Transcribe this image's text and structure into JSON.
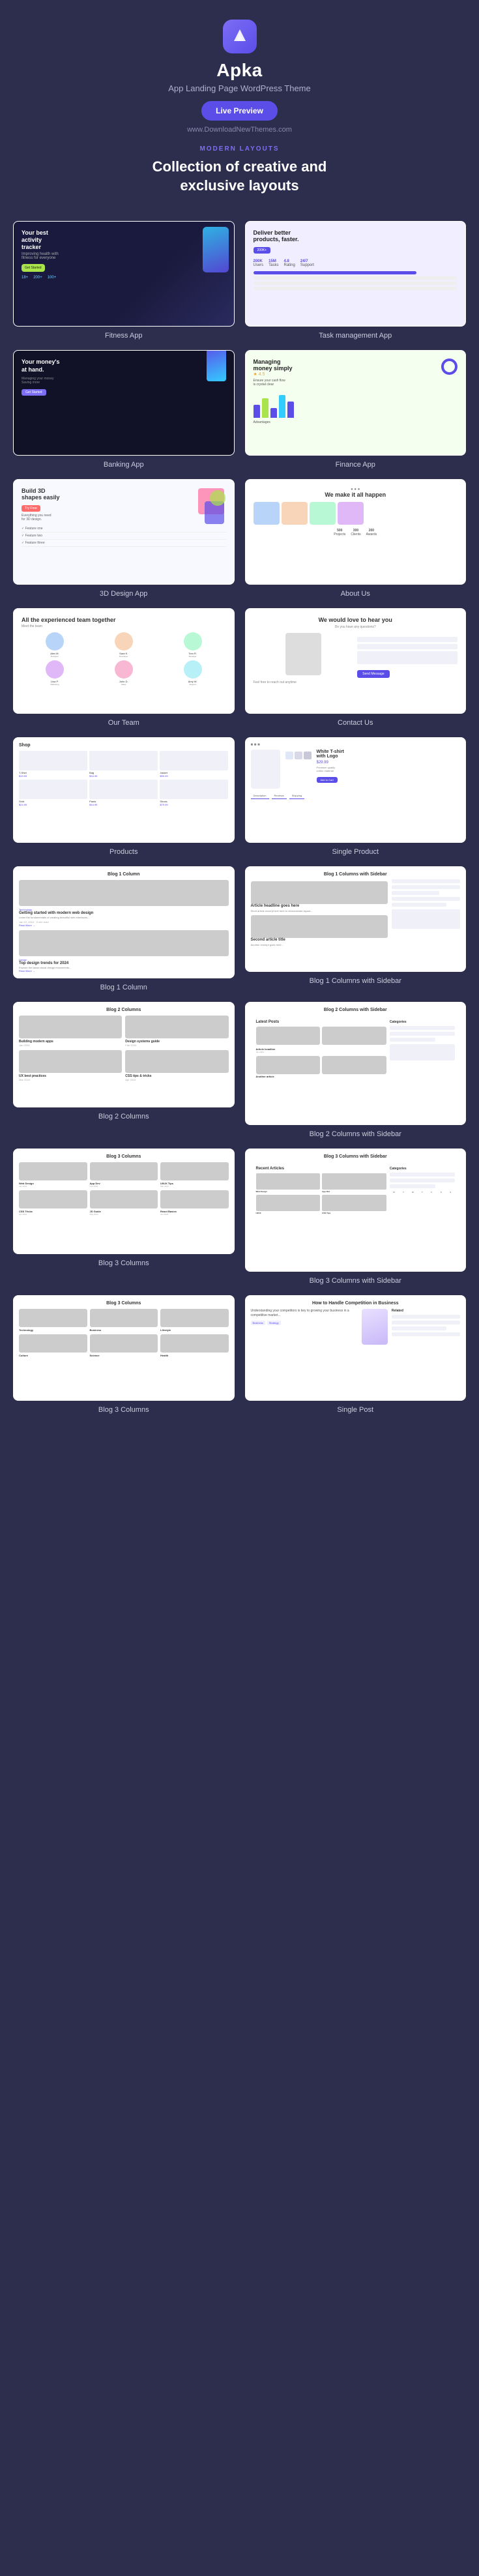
{
  "header": {
    "logo_icon_label": "apka-logo",
    "app_name": "Apka",
    "tagline": "App Landing Page WordPress Theme",
    "live_preview_label": "Live Preview",
    "website_url": "www.DownloadNewThemes.com",
    "section_label": "MODERN LAYOUTS",
    "section_title": "Collection of creative and\nexclusive layouts"
  },
  "layouts": [
    {
      "id": "fitness-app",
      "label": "Fitness App"
    },
    {
      "id": "task-app",
      "label": "Task management App"
    },
    {
      "id": "banking-app",
      "label": "Banking App"
    },
    {
      "id": "finance-app",
      "label": "Finance App"
    },
    {
      "id": "design3d-app",
      "label": "3D Design App"
    },
    {
      "id": "about-us",
      "label": "About Us"
    },
    {
      "id": "our-team",
      "label": "Our Team"
    },
    {
      "id": "contact-us",
      "label": "Contact Us"
    },
    {
      "id": "shop",
      "label": "Products"
    },
    {
      "id": "single-product",
      "label": "Single Product"
    },
    {
      "id": "blog-1col",
      "label": "Blog 1 Column"
    },
    {
      "id": "blog-1col-sidebar",
      "label": "Blog 1 Columns with Sidebar"
    },
    {
      "id": "blog-2col",
      "label": "Blog 2 Columns"
    },
    {
      "id": "blog-2col-sidebar",
      "label": "Blog 2 Columns with Sidebar"
    },
    {
      "id": "blog-3col",
      "label": "Blog 3 Columns"
    },
    {
      "id": "blog-3col-sidebar",
      "label": "Blog 3 Columns with Sidebar"
    },
    {
      "id": "blog-3col-bottom",
      "label": "Blog 3 Columns"
    },
    {
      "id": "single-post",
      "label": "Single Post"
    }
  ],
  "fitness": {
    "title": "Your best activity tracker",
    "subtitle": "Improving health with fitness for everyone",
    "badge": "Get Started",
    "stats": [
      "18+",
      "200+",
      "100+"
    ]
  },
  "task": {
    "title": "Deliver better products, faster.",
    "badge": "200K+",
    "stats": [
      {
        "label": "200K",
        "desc": "Users"
      },
      {
        "label": "15M",
        "desc": "Tasks"
      },
      {
        "label": "4.8",
        "desc": "Rating"
      },
      {
        "label": "24/7",
        "desc": "Support"
      }
    ]
  },
  "banking": {
    "title": "Your money's at hand.",
    "subtitle": "Managing your money, Saving more",
    "btn": "Get Started"
  },
  "finance": {
    "title": "Managing money simply",
    "rating": "4.5",
    "subtitle": "Ensure your cash flow is crystal clear",
    "section": "Advantages"
  },
  "design3d": {
    "title": "Build 3D shapes easily",
    "subtitle": "Everything you need for 3D design.",
    "badge": "Try Free"
  },
  "about": {
    "title": "We make it all happen",
    "stats": [
      "500",
      "300",
      "200"
    ]
  },
  "team": {
    "title": "All the experienced team together",
    "subtitle": "Meet the team",
    "members": [
      "Person 1",
      "Person 2",
      "Person 3",
      "Person 4",
      "Person 5",
      "Person 6"
    ]
  },
  "contact": {
    "title": "We would love to hear you",
    "subtitle": "Do you have any questions?",
    "btn": "Send Message"
  },
  "shop": {
    "title": "Shop",
    "items": [
      "T-Shirt",
      "Bag",
      "Jacket",
      "Shirt",
      "Pants",
      "Shoes"
    ]
  },
  "single_product": {
    "title": "White T-shirt with Logo",
    "price": "$29.99",
    "btn": "Add to Cart"
  },
  "colors": {
    "primary": "#5b4de8",
    "accent": "#7c6ef5",
    "dark_bg": "#2d2d4e"
  }
}
